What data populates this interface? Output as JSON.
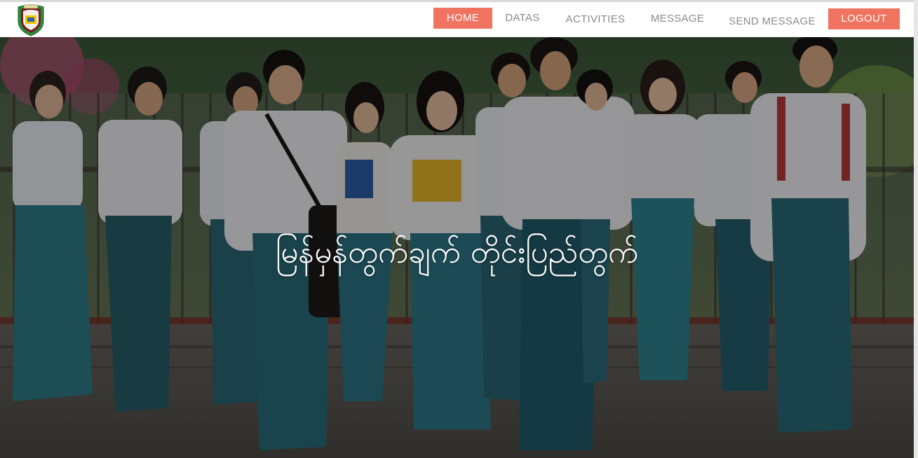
{
  "nav": {
    "home": "HOME",
    "datas": "DATAS",
    "activities": "ACTIVITIES",
    "message": "MESSAGE",
    "send_message": "SEND MESSAGE",
    "logout": "LOGOUT"
  },
  "hero": {
    "title": "မြန်မှန်တွက်ချက် တိုင်းပြည်တွက်"
  },
  "colors": {
    "accent": "#f0735f",
    "nav_text": "#8a8a8a"
  }
}
